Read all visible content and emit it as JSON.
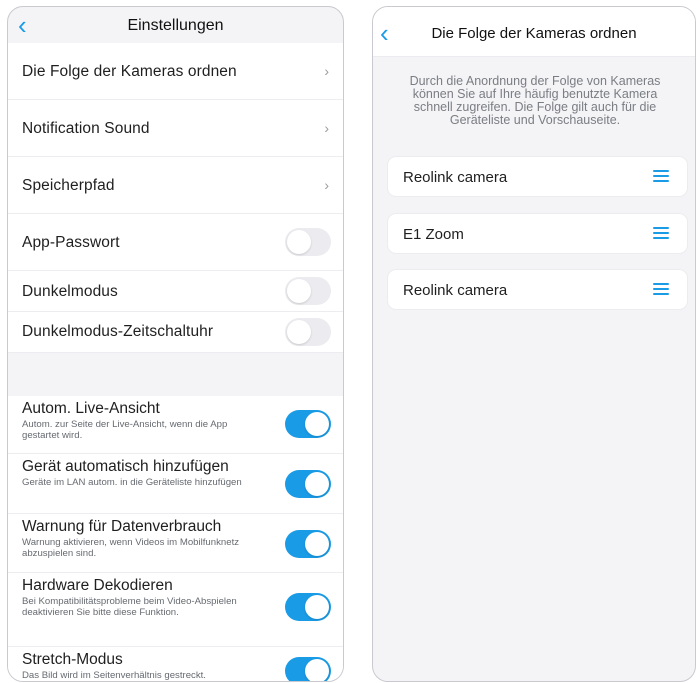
{
  "settings": {
    "back_icon": "‹",
    "title": "Einstellungen",
    "chevron": "›",
    "nav_items": [
      {
        "label": "Die Folge der Kameras ordnen"
      },
      {
        "label": "Notification Sound"
      },
      {
        "label": "Speicherpfad"
      }
    ],
    "app_password": {
      "label": "App-Passwort",
      "enabled": false
    },
    "dark_mode": {
      "label": "Dunkelmodus",
      "enabled": false
    },
    "dark_mode_timer": {
      "label": "Dunkelmodus-Zeitschaltuhr",
      "enabled": false
    },
    "auto_live": {
      "title": "Autom. Live-Ansicht",
      "desc": "Autom. zur Seite der Live-Ansicht, wenn die App gestartet wird.",
      "enabled": true
    },
    "auto_add": {
      "title": "Gerät automatisch hinzufügen",
      "desc": "Geräte im LAN autom. in die Geräteliste hinzufügen",
      "enabled": true
    },
    "data_warning": {
      "title": "Warnung für Datenverbrauch",
      "desc": "Warnung aktivieren, wenn Videos im Mobilfunknetz abzuspielen sind.",
      "enabled": true
    },
    "hw_decode": {
      "title": "Hardware Dekodieren",
      "desc": "Bei Kompatibilitätsprobleme beim Video-Abspielen deaktivieren Sie bitte diese Funktion.",
      "enabled": true
    },
    "stretch": {
      "title": "Stretch-Modus",
      "desc": "Das Bild wird im Seitenverhältnis gestreckt.",
      "enabled": true
    }
  },
  "order": {
    "back_icon": "‹",
    "title": "Die Folge der Kameras ordnen",
    "intro": "Durch die Anordnung der Folge von Kameras können Sie auf Ihre häufig benutzte Kamera schnell zugreifen. Die Folge gilt auch für die Geräteliste und Vorschauseite.",
    "cameras": [
      {
        "name": "Reolink camera"
      },
      {
        "name": "E1 Zoom"
      },
      {
        "name": "Reolink camera"
      }
    ]
  },
  "colors": {
    "accent": "#1a9be6",
    "toggle_off": "#ececf0",
    "page_bg": "#f4f4f7"
  }
}
